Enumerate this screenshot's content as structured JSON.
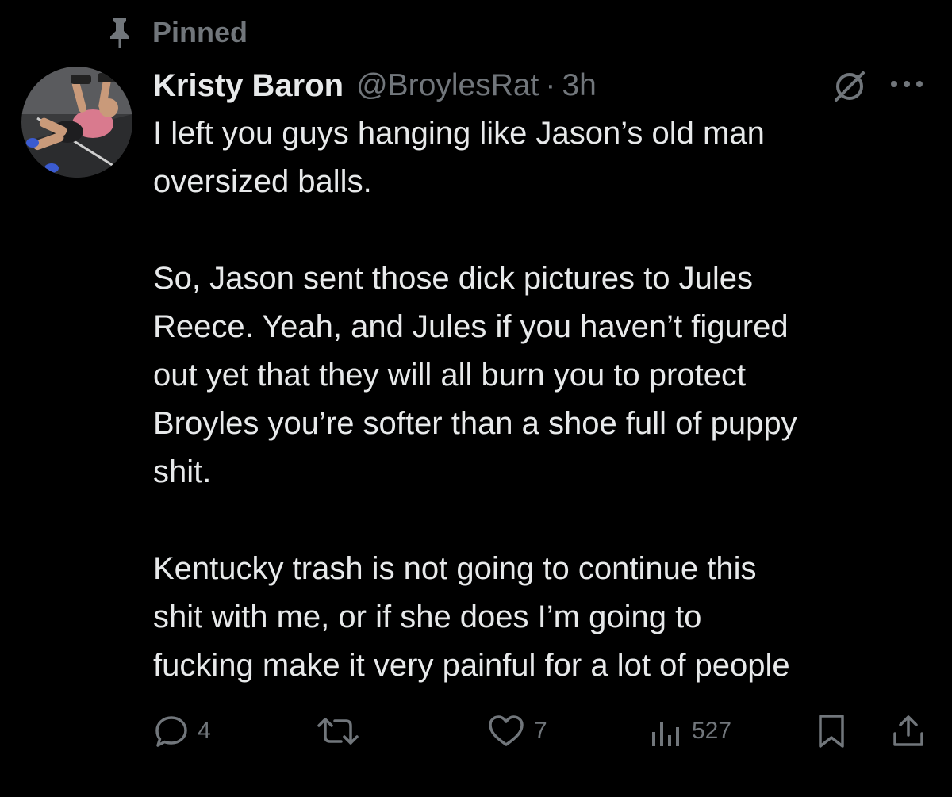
{
  "pinned": {
    "label": "Pinned",
    "icon": "pin-icon"
  },
  "tweet": {
    "author_name": "Kristy Baron",
    "handle": "@BroylesRat",
    "separator": "·",
    "time": "3h",
    "paragraphs": [
      [
        "I left you guys hanging like Jason’s old man",
        "oversized balls."
      ],
      [
        "So, Jason sent those dick pictures to Jules",
        "Reece. Yeah, and Jules if you haven’t figured",
        "out yet that they will all burn you to protect",
        "Broyles you’re softer than a shoe full of puppy",
        "shit."
      ],
      [
        "Kentucky trash is not going to continue this",
        "shit with me, or if she does I’m going to",
        "fucking make it very painful for a lot of people"
      ]
    ]
  },
  "actions": {
    "replies": "4",
    "reposts": "",
    "likes": "7",
    "views": "527"
  },
  "colors": {
    "background": "#000000",
    "text": "#e7e9ea",
    "muted": "#71767b"
  }
}
